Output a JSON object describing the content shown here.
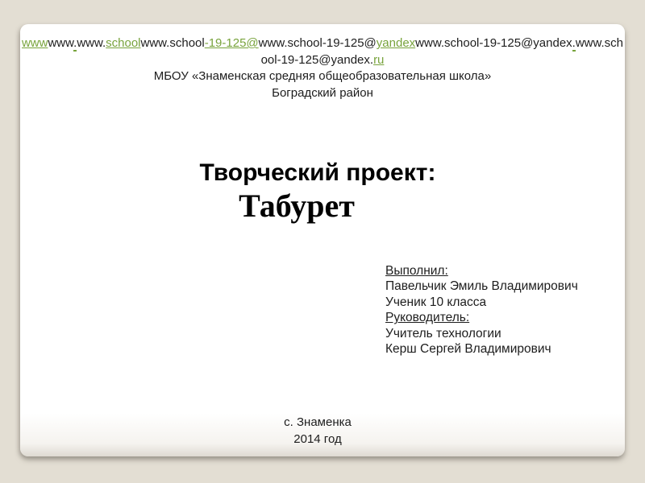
{
  "slide": {
    "header": {
      "url_lines": [
        [
          {
            "t": "www",
            "s": "link"
          },
          {
            "t": "www",
            "s": "plain"
          },
          {
            "t": ".",
            "s": "dotlink"
          },
          {
            "t": "www.",
            "s": "plain"
          },
          {
            "t": "school",
            "s": "link"
          },
          {
            "t": "www.school",
            "s": "plain"
          },
          {
            "t": "-19-125@",
            "s": "link"
          },
          {
            "t": "www.school-19-125@",
            "s": "plain"
          },
          {
            "t": "yandex",
            "s": "link"
          },
          {
            "t": "www.school-19-125@yandex",
            "s": "plain"
          },
          {
            "t": ".",
            "s": "dotlink"
          },
          {
            "t": "www.sch",
            "s": "plain"
          }
        ],
        [
          {
            "t": "ool-19-125@yandex.",
            "s": "plain"
          },
          {
            "t": "ru",
            "s": "link"
          }
        ]
      ],
      "school": "МБОУ «Знаменская средняя общеобразовательная школа»",
      "district": "Боградский район"
    },
    "title": {
      "line1": "Творческий проект:",
      "line2": "Табурет"
    },
    "author": {
      "lines": [
        {
          "text": "Выполнил:",
          "underline": true
        },
        {
          "text": "Павельчик Эмиль Владимирович",
          "underline": false
        },
        {
          "text": "Ученик 10 класса",
          "underline": false
        },
        {
          "text": "Руководитель:",
          "underline": true
        },
        {
          "text": "Учитель технологии",
          "underline": false
        },
        {
          "text": "Керш Сергей Владимирович",
          "underline": false
        }
      ]
    },
    "footer": {
      "place": "с. Знаменка",
      "year": "2014 год"
    },
    "colors": {
      "background": "#e3ded3",
      "slide": "#ffffff",
      "link_green": "#78a33c",
      "text": "#1d1d1d"
    }
  }
}
